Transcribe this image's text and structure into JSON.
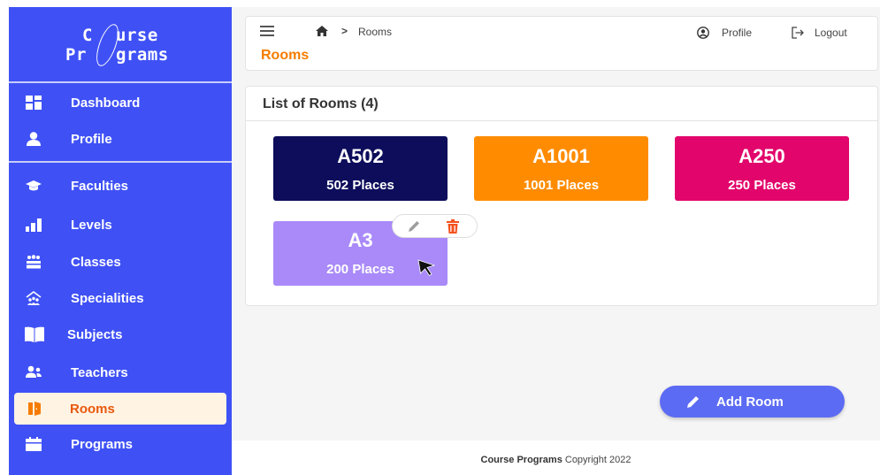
{
  "brand": {
    "line1_a": "C",
    "line1_b": "urse",
    "line2_a": "Pr",
    "line2_b": "grams"
  },
  "sidebar": {
    "items": [
      {
        "label": "Dashboard",
        "icon": "dashboard-icon"
      },
      {
        "label": "Profile",
        "icon": "user-icon"
      },
      {
        "label": "Faculties",
        "icon": "graduation-cap-icon"
      },
      {
        "label": "Levels",
        "icon": "bar-chart-icon"
      },
      {
        "label": "Classes",
        "icon": "users-group-icon"
      },
      {
        "label": "Specialities",
        "icon": "speciality-icon"
      },
      {
        "label": "Subjects",
        "icon": "book-icon"
      },
      {
        "label": "Teachers",
        "icon": "teachers-icon"
      },
      {
        "label": "Rooms",
        "icon": "door-icon",
        "active": true
      },
      {
        "label": "Programs",
        "icon": "calendar-icon"
      }
    ]
  },
  "topbar": {
    "breadcrumb_sep": ">",
    "breadcrumb": "Rooms",
    "page_title": "Rooms",
    "profile_label": "Profile",
    "logout_label": "Logout"
  },
  "panel": {
    "title": "List of Rooms (4)"
  },
  "rooms": [
    {
      "name": "A502",
      "places": "502 Places",
      "color": "#0d0d5c"
    },
    {
      "name": "A1001",
      "places": "1001 Places",
      "color": "#ff8c00"
    },
    {
      "name": "A250",
      "places": "250 Places",
      "color": "#e2056b"
    },
    {
      "name": "A3",
      "places": "200 Places",
      "color": "#a98af8"
    }
  ],
  "fab": {
    "label": "Add Room"
  },
  "footer": {
    "brand": "Course Programs",
    "text": " Copyright 2022"
  },
  "colors": {
    "sidebar": "#3f51f5",
    "accent": "#f57c00",
    "active_bg": "#fff3e4",
    "delete": "#f4511e"
  }
}
